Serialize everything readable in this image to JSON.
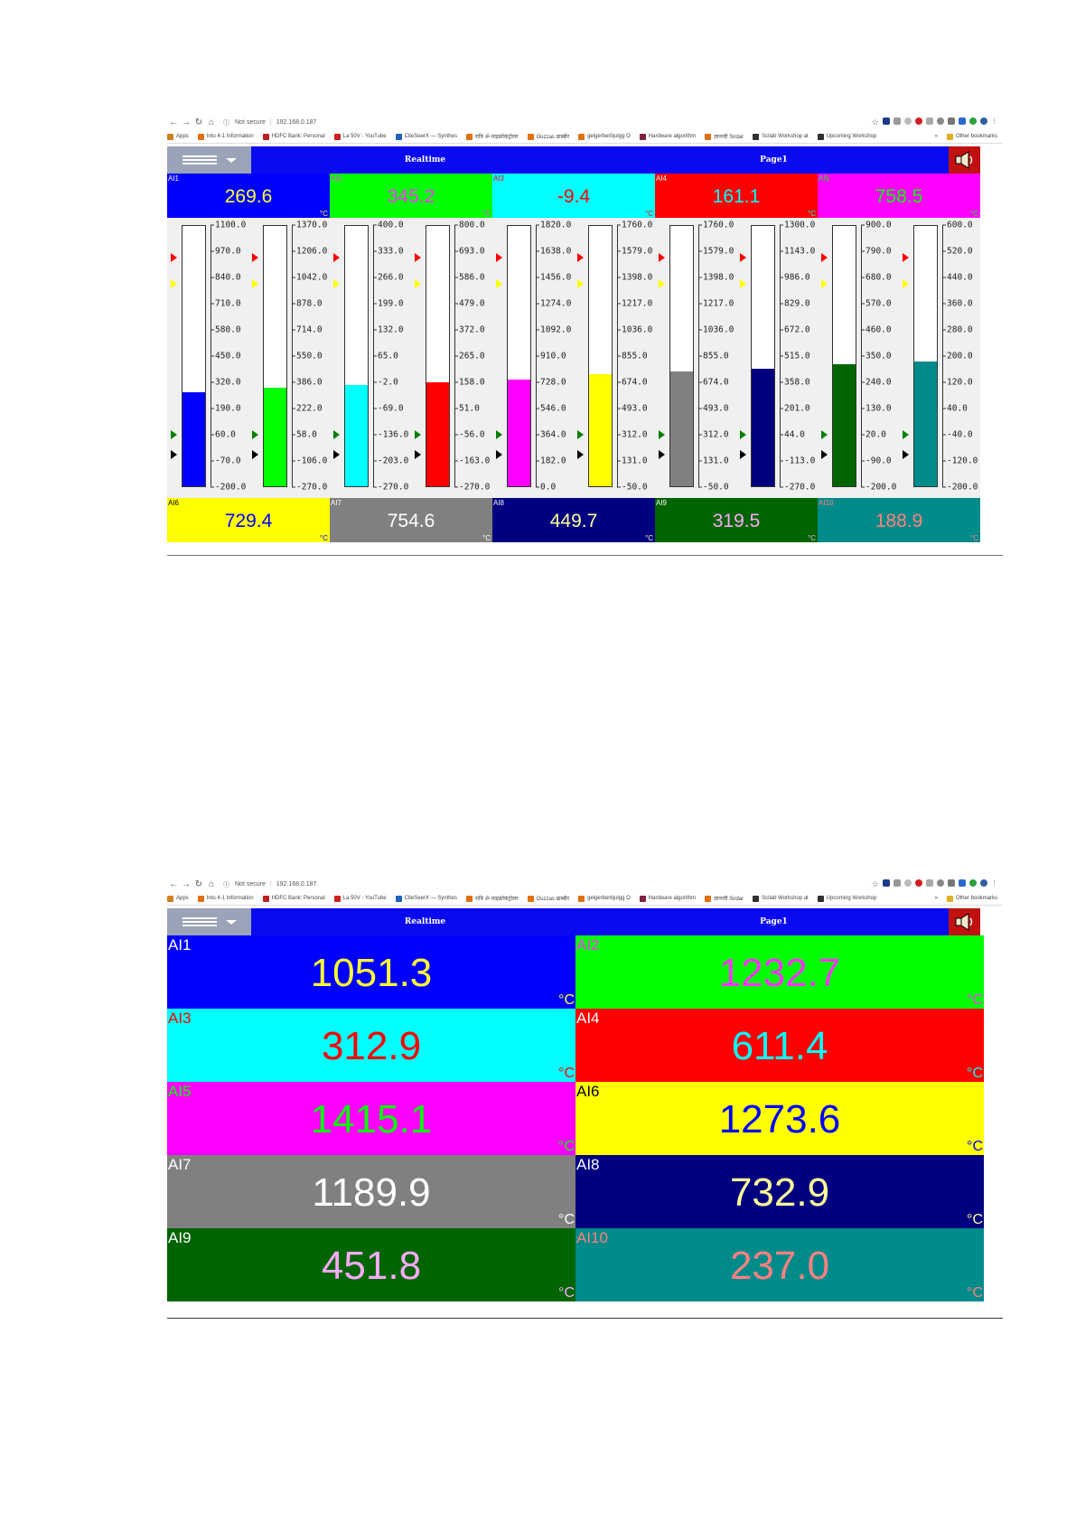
{
  "browser": {
    "url_secure": "Not secure",
    "url": "192.168.0.187",
    "bookmarks": [
      "Apps",
      "Intu 4-1 Information",
      "HDFC Bank: Personal",
      "La 50V - YouTube",
      "CiteSeerX — Synthes",
      "रात्रि ॐ माइक्रोकंट्रोलर",
      "Ouzzas ढाब्बीर",
      "gelgerberbjulgg O",
      "Hardware algorithm",
      "ज्ञानन्दी Sirdar",
      "Scilab Workshop at",
      "Upcoming Workshop"
    ],
    "more_bookmarks": "»",
    "other_bookmarks": "Other bookmarks"
  },
  "app": {
    "realtime_label": "Realtime",
    "page_label": "Page1"
  },
  "unit": "°C",
  "bargraph_view": {
    "top_tiles": [
      {
        "id": "AI1",
        "value": "269.6",
        "bg": "#0000ff",
        "fg": "#ffff33",
        "idfg": "#ffffff"
      },
      {
        "id": "AI2",
        "value": "345.2",
        "bg": "#00ff00",
        "fg": "#ff33ff",
        "idfg": "#ff33ff"
      },
      {
        "id": "AI3",
        "value": "-9.4",
        "bg": "#00ffff",
        "fg": "#ff0000",
        "idfg": "#ff0000"
      },
      {
        "id": "AI4",
        "value": "161.1",
        "bg": "#ff0000",
        "fg": "#00ffff",
        "idfg": "#ffffff"
      },
      {
        "id": "AI5",
        "value": "758.5",
        "bg": "#ff00ff",
        "fg": "#00ff00",
        "idfg": "#00ff00"
      }
    ],
    "bottom_tiles": [
      {
        "id": "AI6",
        "value": "729.4",
        "bg": "#ffff00",
        "fg": "#0000ff",
        "idfg": "#000000"
      },
      {
        "id": "AI7",
        "value": "754.6",
        "bg": "#808080",
        "fg": "#ffffff",
        "idfg": "#ffffff"
      },
      {
        "id": "AI8",
        "value": "449.7",
        "bg": "#000080",
        "fg": "#ffff99",
        "idfg": "#ffffff"
      },
      {
        "id": "AI9",
        "value": "319.5",
        "bg": "#006400",
        "fg": "#ffaaff",
        "idfg": "#ffffff"
      },
      {
        "id": "AI10",
        "value": "188.9",
        "bg": "#008b8b",
        "fg": "#ff8080",
        "idfg": "#ff8080"
      }
    ],
    "bars": [
      {
        "fill": "#0000ff",
        "level_fraction": 0.36,
        "ticks": [
          "1100.0",
          "970.0",
          "840.0",
          "710.0",
          "580.0",
          "450.0",
          "320.0",
          "190.0",
          "60.0",
          "-70.0",
          "-200.0"
        ]
      },
      {
        "fill": "#00ff00",
        "level_fraction": 0.38,
        "ticks": [
          "1370.0",
          "1206.0",
          "1042.0",
          "878.0",
          "714.0",
          "550.0",
          "386.0",
          "222.0",
          "58.0",
          "-106.0",
          "-270.0"
        ]
      },
      {
        "fill": "#00ffff",
        "level_fraction": 0.39,
        "ticks": [
          "400.0",
          "333.0",
          "266.0",
          "199.0",
          "132.0",
          "65.0",
          "-2.0",
          "-69.0",
          "-136.0",
          "-203.0",
          "-270.0"
        ]
      },
      {
        "fill": "#ff0000",
        "level_fraction": 0.4,
        "ticks": [
          "800.0",
          "693.0",
          "586.0",
          "479.0",
          "372.0",
          "265.0",
          "158.0",
          "51.0",
          "-56.0",
          "-163.0",
          "-270.0"
        ]
      },
      {
        "fill": "#ff00ff",
        "level_fraction": 0.41,
        "ticks": [
          "1820.0",
          "1638.0",
          "1456.0",
          "1274.0",
          "1092.0",
          "910.0",
          "728.0",
          "546.0",
          "364.0",
          "182.0",
          "0.0"
        ]
      },
      {
        "fill": "#ffff00",
        "level_fraction": 0.43,
        "ticks": [
          "1760.0",
          "1579.0",
          "1398.0",
          "1217.0",
          "1036.0",
          "855.0",
          "674.0",
          "493.0",
          "312.0",
          "131.0",
          "-50.0"
        ]
      },
      {
        "fill": "#808080",
        "level_fraction": 0.44,
        "ticks": [
          "1760.0",
          "1579.0",
          "1398.0",
          "1217.0",
          "1036.0",
          "855.0",
          "674.0",
          "493.0",
          "312.0",
          "131.0",
          "-50.0"
        ]
      },
      {
        "fill": "#000080",
        "level_fraction": 0.45,
        "ticks": [
          "1300.0",
          "1143.0",
          "986.0",
          "829.0",
          "672.0",
          "515.0",
          "358.0",
          "201.0",
          "44.0",
          "-113.0",
          "-270.0"
        ]
      },
      {
        "fill": "#006400",
        "level_fraction": 0.47,
        "ticks": [
          "900.0",
          "790.0",
          "680.0",
          "570.0",
          "460.0",
          "350.0",
          "240.0",
          "130.0",
          "20.0",
          "-90.0",
          "-200.0"
        ]
      },
      {
        "fill": "#008b8b",
        "level_fraction": 0.48,
        "ticks": [
          "600.0",
          "520.0",
          "440.0",
          "360.0",
          "280.0",
          "200.0",
          "120.0",
          "40.0",
          "-40.0",
          "-120.0",
          "-200.0"
        ]
      }
    ],
    "alarm_marker_colors": [
      "#ff0000",
      "#ffff00",
      "#008000",
      "#000000"
    ]
  },
  "digital_view": {
    "cells": [
      {
        "id": "AI1",
        "value": "1051.3",
        "bg": "#0000ff",
        "fg": "#ffff33",
        "idfg": "#ffffff"
      },
      {
        "id": "AI2",
        "value": "1232.7",
        "bg": "#00ff00",
        "fg": "#ff33ff",
        "idfg": "#ff33ff"
      },
      {
        "id": "AI3",
        "value": "312.9",
        "bg": "#00ffff",
        "fg": "#ff0000",
        "idfg": "#ff0000"
      },
      {
        "id": "AI4",
        "value": "611.4",
        "bg": "#ff0000",
        "fg": "#00ffff",
        "idfg": "#ffffff"
      },
      {
        "id": "AI5",
        "value": "1415.1",
        "bg": "#ff00ff",
        "fg": "#00ff00",
        "idfg": "#00ff00"
      },
      {
        "id": "AI6",
        "value": "1273.6",
        "bg": "#ffff00",
        "fg": "#0000ff",
        "idfg": "#000000"
      },
      {
        "id": "AI7",
        "value": "1189.9",
        "bg": "#808080",
        "fg": "#ffffff",
        "idfg": "#ffffff"
      },
      {
        "id": "AI8",
        "value": "732.9",
        "bg": "#000080",
        "fg": "#ffff99",
        "idfg": "#ffffff"
      },
      {
        "id": "AI9",
        "value": "451.8",
        "bg": "#006400",
        "fg": "#ffaaff",
        "idfg": "#ffffff"
      },
      {
        "id": "AI10",
        "value": "237.0",
        "bg": "#008b8b",
        "fg": "#ff8080",
        "idfg": "#ff8080"
      }
    ]
  }
}
